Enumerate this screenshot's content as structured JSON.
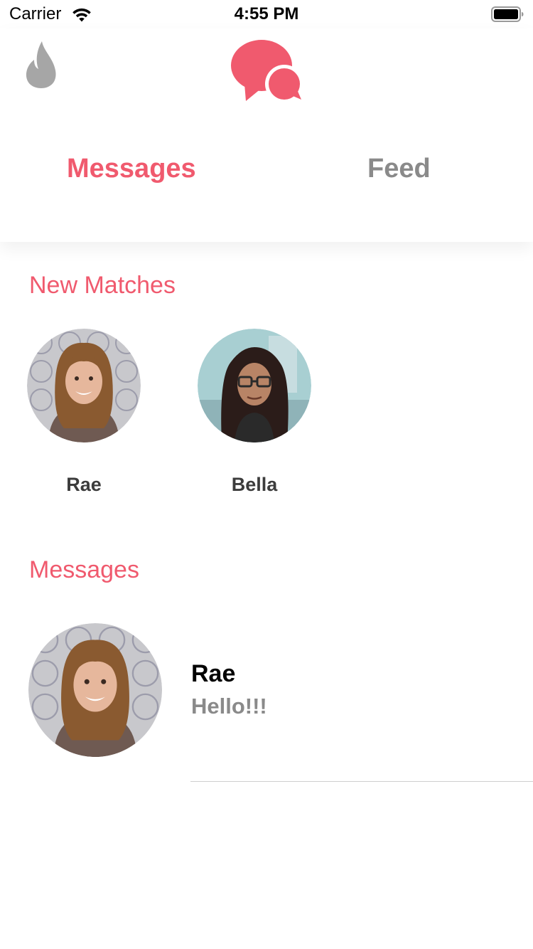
{
  "status_bar": {
    "carrier": "Carrier",
    "time": "4:55 PM",
    "icons": [
      "wifi-icon",
      "battery-icon"
    ]
  },
  "header": {
    "left_icon": "flame-icon",
    "center_icon": "chat-bubbles-icon",
    "tabs": [
      {
        "label": "Messages",
        "active": true
      },
      {
        "label": "Feed",
        "active": false
      }
    ]
  },
  "new_matches": {
    "title": "New Matches",
    "items": [
      {
        "name": "Rae"
      },
      {
        "name": "Bella"
      }
    ]
  },
  "messages": {
    "title": "Messages",
    "items": [
      {
        "name": "Rae",
        "preview": "Hello!!!"
      }
    ]
  },
  "colors": {
    "accent": "#f05a6e",
    "inactive_text": "#8a8a8a",
    "flame_gray": "#a6a6a6",
    "divider": "#cfcfcf"
  }
}
